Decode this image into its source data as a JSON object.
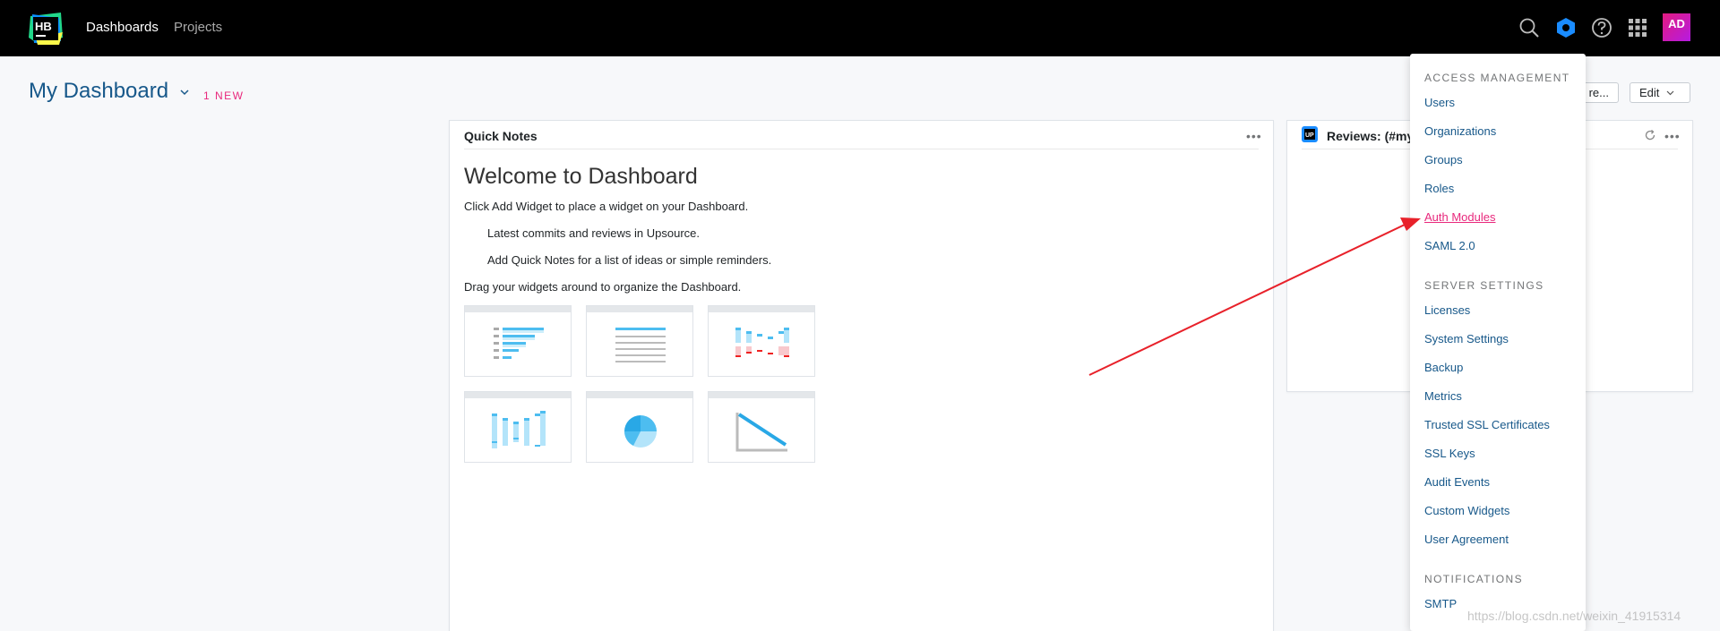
{
  "header": {
    "logo_text": "HB",
    "nav": [
      "Dashboards",
      "Projects"
    ],
    "avatar_text": "AD",
    "icons": [
      "search-icon",
      "hub-hexagon-icon",
      "help-icon",
      "apps-grid-icon"
    ]
  },
  "dashboard": {
    "title": "My Dashboard",
    "new_badge": "1 NEW",
    "more_button": "re...",
    "edit_button": "Edit"
  },
  "quick_notes": {
    "title": "Quick Notes",
    "welcome": "Welcome to Dashboard",
    "lines": [
      "Click Add Widget to place a widget on your Dashboard.",
      "Latest commits and reviews in Upsource.",
      "Add Quick Notes for a list of ideas or simple reminders.",
      "Drag your widgets around to organize the Dashboard."
    ]
  },
  "reviews": {
    "title": "Reviews: (#my"
  },
  "menu": {
    "sections": [
      {
        "title": "ACCESS MANAGEMENT",
        "items": [
          "Users",
          "Organizations",
          "Groups",
          "Roles",
          "Auth Modules",
          "SAML 2.0"
        ]
      },
      {
        "title": "SERVER SETTINGS",
        "items": [
          "Licenses",
          "System Settings",
          "Backup",
          "Metrics",
          "Trusted SSL Certificates",
          "SSL Keys",
          "Audit Events",
          "Custom Widgets",
          "User Agreement"
        ]
      },
      {
        "title": "NOTIFICATIONS",
        "items": [
          "SMTP"
        ]
      }
    ],
    "active_item": "Auth Modules"
  },
  "watermark": "https://blog.csdn.net/weixin_41915314",
  "colors": {
    "accent": "#e8287c",
    "link": "#17588a",
    "header_bg": "#000000",
    "arrow": "#e8212a"
  }
}
